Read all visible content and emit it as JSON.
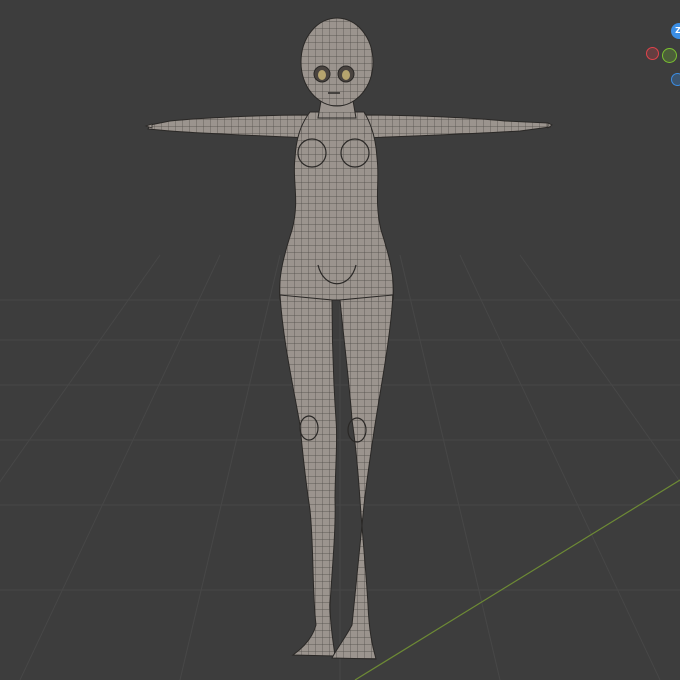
{
  "viewport": {
    "background": "#3d3d3d",
    "grid_color": "#474747",
    "x_axis_color": "#8a4242",
    "y_axis_color": "#6d8a35"
  },
  "model": {
    "icon": "character-mesh",
    "surface_color": "#9b948e",
    "wire_color": "#2a2826"
  },
  "gizmo": {
    "z_label": "Z",
    "x_color": "#e0434b",
    "y_color": "#7ac230",
    "z_color": "#3b8ee5"
  }
}
